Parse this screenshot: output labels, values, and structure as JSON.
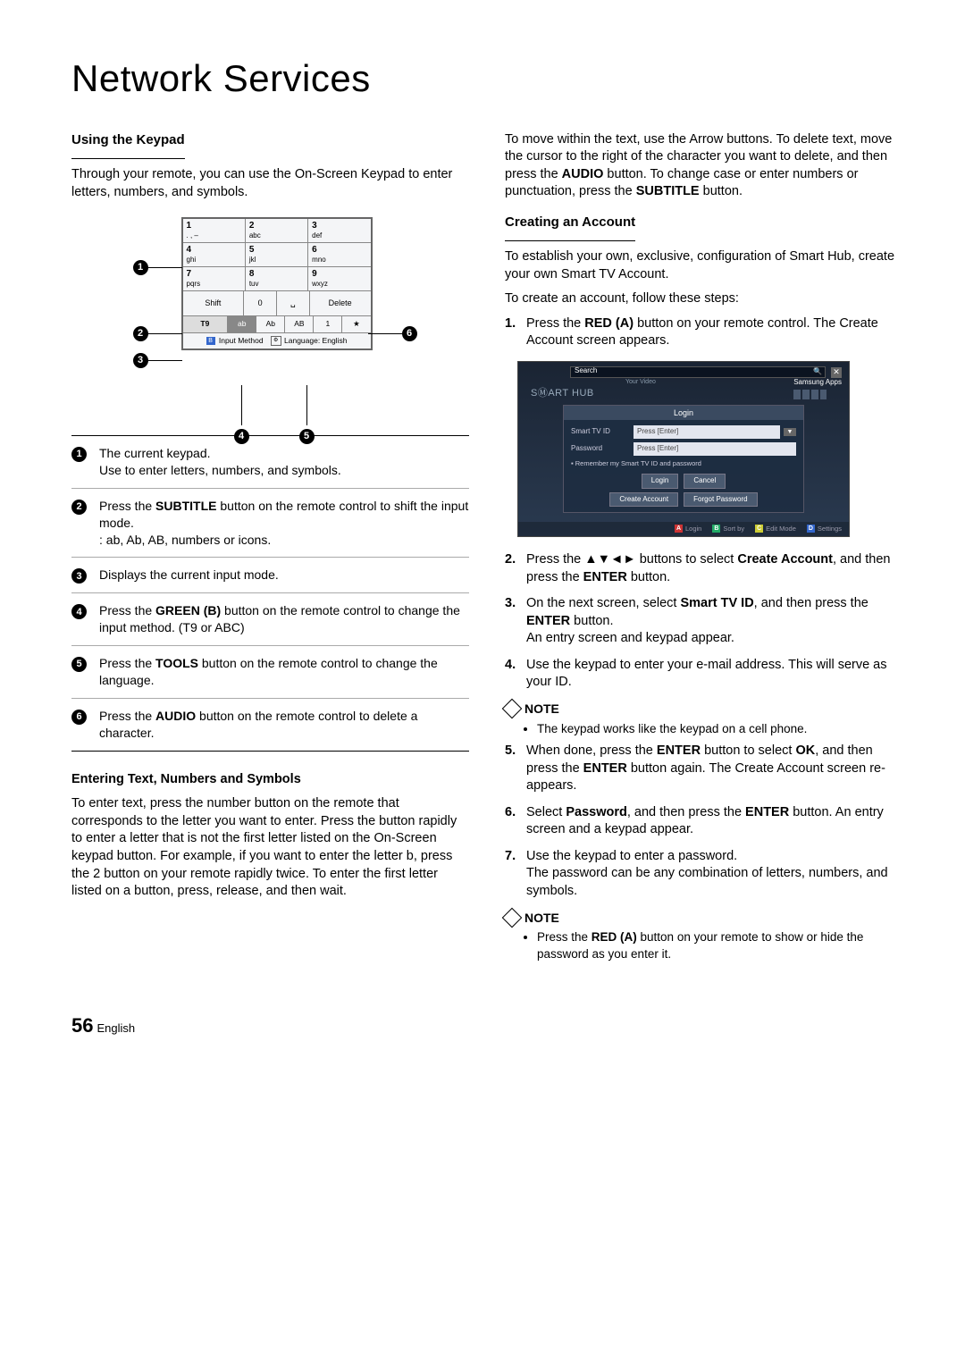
{
  "title": "Network Services",
  "left": {
    "h1": "Using the Keypad",
    "p1": "Through your remote, you can use the On-Screen Keypad to enter letters, numbers, and symbols.",
    "keypad": {
      "rows": [
        [
          {
            "n": "1",
            "s": ". , –"
          },
          {
            "n": "2",
            "s": "abc"
          },
          {
            "n": "3",
            "s": "def"
          }
        ],
        [
          {
            "n": "4",
            "s": "ghi"
          },
          {
            "n": "5",
            "s": "jkl"
          },
          {
            "n": "6",
            "s": "mno"
          }
        ],
        [
          {
            "n": "7",
            "s": "pqrs"
          },
          {
            "n": "8",
            "s": "tuv"
          },
          {
            "n": "9",
            "s": "wxyz"
          }
        ]
      ],
      "ctrl": {
        "shift": "Shift",
        "zero": "0",
        "space": "␣",
        "delete": "Delete"
      },
      "mode": {
        "t9": "T9",
        "ab": "ab",
        "Ab": "Ab",
        "AB": "AB",
        "one": "1",
        "star": "★"
      },
      "info_b": "B",
      "info_input": "Input Method",
      "info_tools": "⚙",
      "info_lang": "Language: English"
    },
    "legend": {
      "1": {
        "l1": "The current keypad.",
        "l2": "Use to enter letters, numbers, and symbols."
      },
      "2": {
        "pre": "Press the ",
        "b": "SUBTITLE",
        "post": " button on the remote control to shift the input mode.",
        "l2": ": ab, Ab, AB, numbers or icons."
      },
      "3": "Displays the current input mode.",
      "4": {
        "pre": "Press the ",
        "b": "GREEN (B)",
        "post": " button on the remote control to change the input method. (T9 or ABC)"
      },
      "5": {
        "pre": "Press the ",
        "b": "TOOLS",
        "post": " button on the remote control to change the language."
      },
      "6": {
        "pre": "Press the ",
        "b": "AUDIO",
        "post": " button on the remote control to delete a character."
      }
    },
    "h2": "Entering Text, Numbers and Symbols",
    "p2": "To enter text, press the number button on the remote that corresponds to the letter you want to enter. Press the button rapidly to enter a letter that is not the first letter listed on the On-Screen keypad button. For example, if you want to enter the letter b, press the 2 button on your remote rapidly twice. To enter the first letter listed on a button, press, release, and then wait."
  },
  "right": {
    "p1a": "To move within the text, use the Arrow buttons. To delete text, move the cursor to the right of the character you want to delete, and then press the ",
    "p1b": "AUDIO",
    "p1c": " button. To change case or enter numbers or punctuation, press the ",
    "p1d": "SUBTITLE",
    "p1e": " button.",
    "h1": "Creating an Account",
    "p2": "To establish your own, exclusive, configuration of Smart Hub, create your own Smart TV Account.",
    "p3": "To create an account, follow these steps:",
    "s1a": "Press the ",
    "s1b": "RED (A)",
    "s1c": " button on your remote control. The Create Account screen appears.",
    "screen": {
      "search": "Search",
      "smarthub": "SⓂART HUB",
      "samsungapps": "Samsung Apps",
      "appbox": "Your Video",
      "login": "Login",
      "id_label": "Smart TV ID",
      "id_ph": "Press [Enter]",
      "pw_label": "Password",
      "pw_ph": "Press [Enter]",
      "remember": "Remember my Smart TV ID and password",
      "b_login": "Login",
      "b_cancel": "Cancel",
      "b_create": "Create Account",
      "b_forgot": "Forgot Password",
      "ba": "Login",
      "bb": "Sort by",
      "bc": "Edit Mode",
      "bd": "Settings"
    },
    "s2a": "Press the ▲▼◄► buttons to select ",
    "s2b": "Create Account",
    "s2c": ", and then press the ",
    "s2d": "ENTER",
    "s2e": " button.",
    "s3a": "On the next screen, select ",
    "s3b": "Smart TV ID",
    "s3c": ", and then press the ",
    "s3d": "ENTER",
    "s3e": " button.",
    "s3f": "An entry screen and keypad appear.",
    "s4": "Use the keypad to enter your e-mail address. This will serve as your ID.",
    "note": "NOTE",
    "n1": "The keypad works like the keypad on a cell phone.",
    "s5a": "When done, press the ",
    "s5b": "ENTER",
    "s5c": " button to select ",
    "s5d": "OK",
    "s5e": ", and then press the ",
    "s5f": "ENTER",
    "s5g": " button again. The Create Account screen re-appears.",
    "s6a": "Select ",
    "s6b": "Password",
    "s6c": ", and then press the ",
    "s6d": "ENTER",
    "s6e": " button. An entry screen and a keypad appear.",
    "s7a": "Use the keypad to enter a password.",
    "s7b": "The password can be any combination of letters, numbers, and symbols.",
    "n2a": "Press the ",
    "n2b": "RED (A)",
    "n2c": " button on your remote to show or hide the password as you enter it."
  },
  "page": {
    "num": "56",
    "lang": "English"
  }
}
